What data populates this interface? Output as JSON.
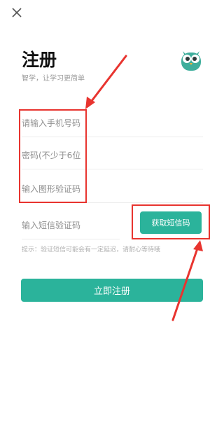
{
  "header": {
    "title": "注册",
    "subtitle": "智学，让学习更简单"
  },
  "form": {
    "phone_placeholder": "请输入手机号码",
    "password_placeholder": "密码(不少于6位",
    "captcha_placeholder": "输入图形验证码",
    "sms_placeholder": "输入短信验证码",
    "sms_button": "获取短信码",
    "tip": "提示：验证短信可能会有一定延迟，请耐心等待哦",
    "register_button": "立即注册"
  },
  "icons": {
    "close": "close-icon",
    "avatar": "owl-mascot-icon"
  },
  "colors": {
    "accent": "#2bb39b",
    "annotation": "#e8342f"
  }
}
